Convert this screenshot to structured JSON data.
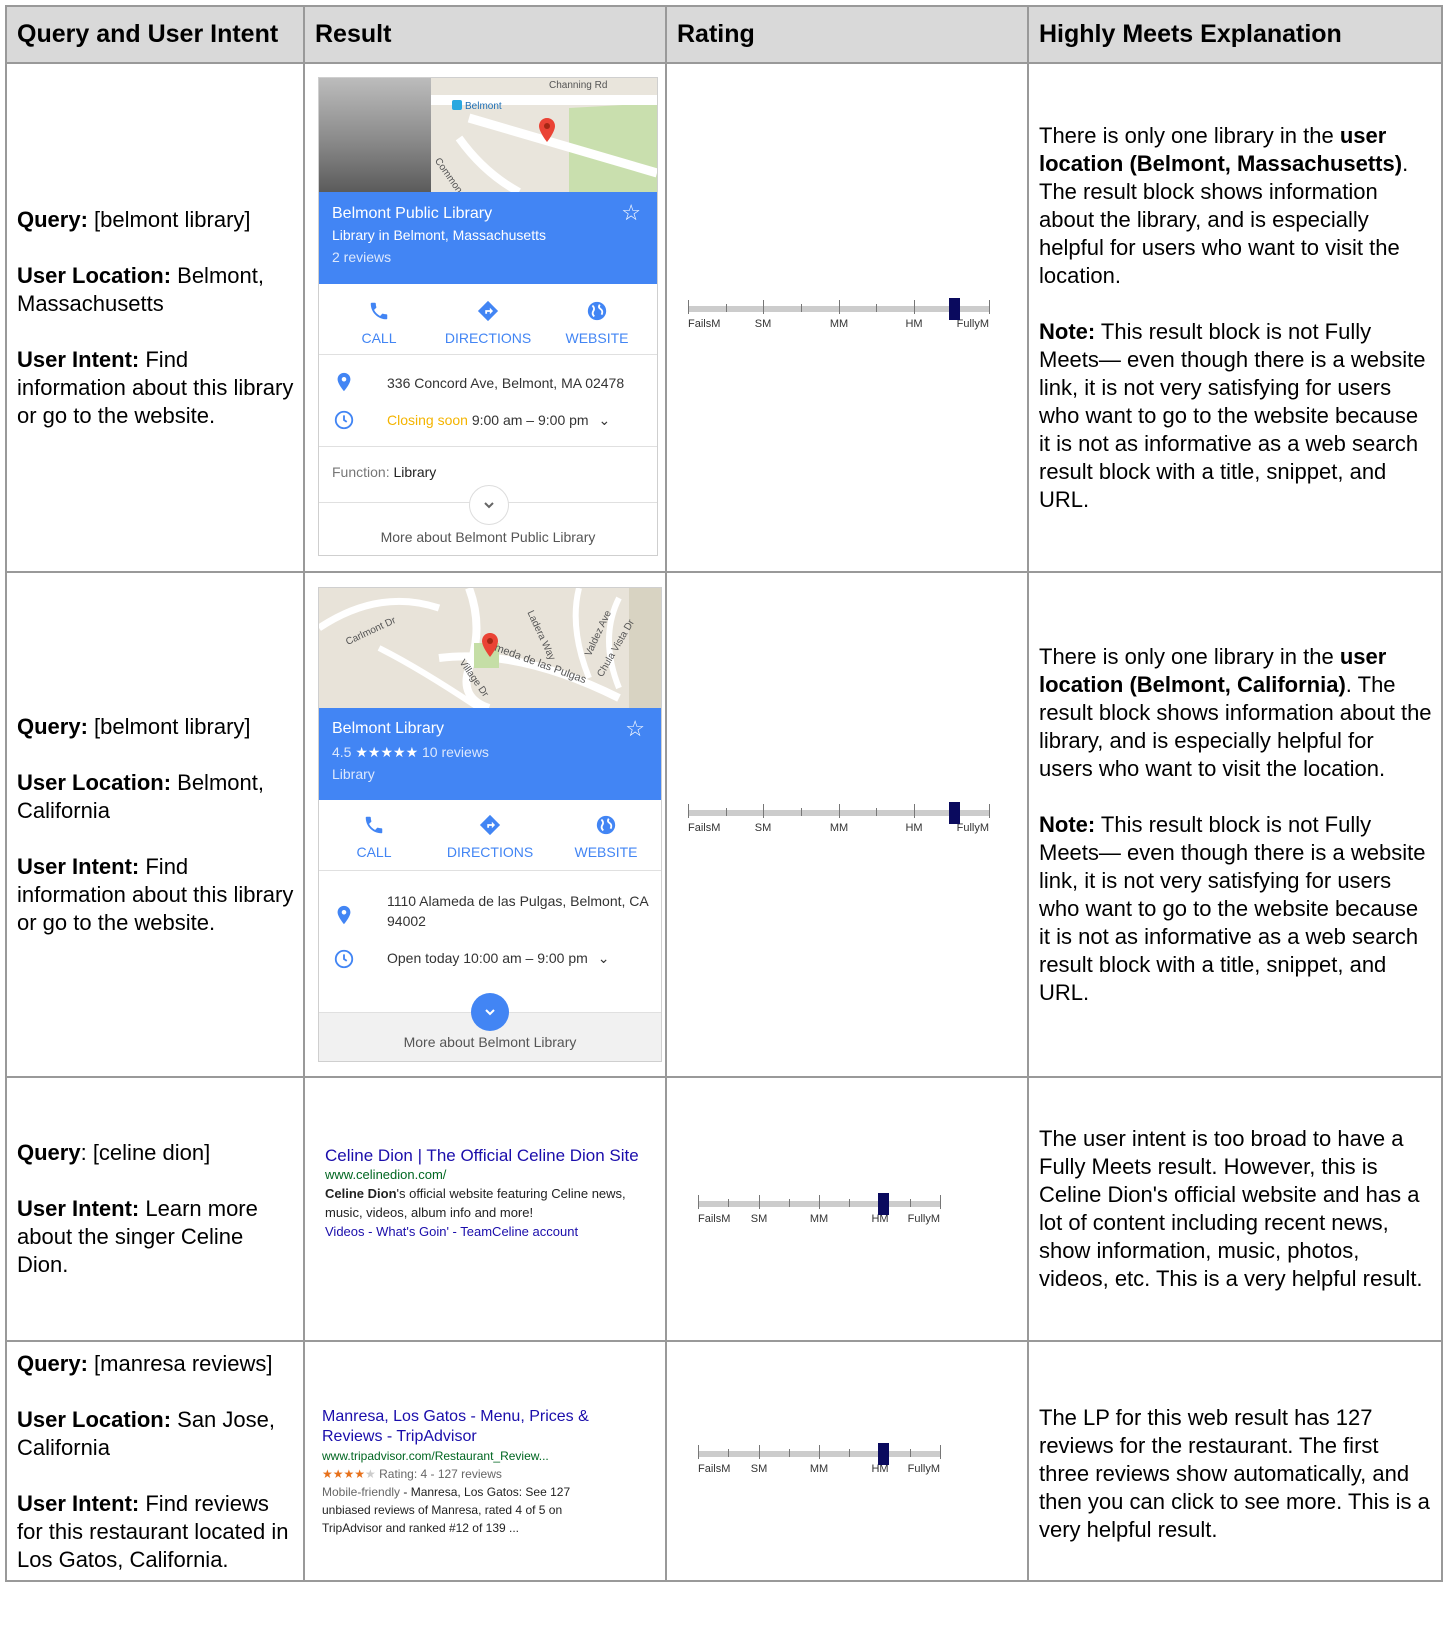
{
  "headers": {
    "query": "Query and User Intent",
    "result": "Result",
    "rating": "Rating",
    "explanation": "Highly Meets Explanation"
  },
  "rating_scale_labels": [
    "FailsM",
    "SM",
    "MM",
    "HM",
    "FullyM"
  ],
  "colors": {
    "header_bg": "#d9d9d9",
    "card_blue": "#4285f4",
    "link": "#1a0dab",
    "url_green": "#006621",
    "marker": "#0a0a5e",
    "closing_soon": "#f4b400"
  },
  "rows": [
    {
      "query_label": "Query:",
      "query": " [belmont library]",
      "location_label": "User Location:",
      "location": " Belmont, Massachusetts",
      "intent_label": "User Intent:",
      "intent": "  Find information about this library or go to the website.",
      "rating_position": 0.88,
      "card": {
        "map_road": "Channing Rd",
        "map_place": "Belmont",
        "map_street": "Common S",
        "name": "Belmont Public Library",
        "subtitle": "Library in Belmont, Massachusetts",
        "reviews": "2 reviews",
        "call": "CALL",
        "directions": "DIRECTIONS",
        "website": "WEBSITE",
        "address": "336 Concord Ave, Belmont, MA 02478",
        "hours_status": "Closing soon",
        "hours": " 9:00 am – 9:00 pm",
        "function_label": "Function: ",
        "function_value": "Library",
        "more": "More about Belmont Public Library"
      },
      "explanation": {
        "p1_a": "There is only one library in the ",
        "p1_bold": "user location (Belmont, Massachusetts)",
        "p1_b": ".  The result block shows information about the library, and is especially helpful for users who want to visit the location.",
        "note_label": "Note:",
        "note": " This result block is not Fully Meets— even though there is a website link, it is not very satisfying for users who want to go to the website because it is not as informative as a web search result block with a title, snippet, and URL."
      }
    },
    {
      "query_label": "Query:",
      "query": " [belmont library]",
      "location_label": "User Location:",
      "location": " Belmont, California",
      "intent_label": "User Intent:",
      "intent": "  Find information about this library or go to the website.",
      "rating_position": 0.88,
      "card": {
        "map_streets": [
          "Carlmont Dr",
          "Ladera Way",
          "Valdez Ave",
          "Chula Vista Dr",
          "meda de las Pulgas",
          "Village Dr"
        ],
        "name": "Belmont Library",
        "rating": "4.5",
        "stars": "★★★★★",
        "reviews": "10 reviews",
        "subtitle": "Library",
        "call": "CALL",
        "directions": "DIRECTIONS",
        "website": "WEBSITE",
        "address": "1110 Alameda de las Pulgas, Belmont, CA 94002",
        "hours": "Open today 10:00 am – 9:00 pm",
        "more": "More about Belmont Library"
      },
      "explanation": {
        "p1_a": "There is only one library in the ",
        "p1_bold": "user location (Belmont, California)",
        "p1_b": ".  The result block shows information about the library, and is especially helpful for users who want to visit the location.",
        "note_label": "Note:",
        "note": " This result block is not Fully Meets— even though there is a website link, it is not very satisfying for users who want to go to the website because it is not as informative as a web search result block with a title, snippet, and URL."
      }
    },
    {
      "query_label": "Query",
      "query": ": [celine dion]",
      "intent_label": "User Intent:",
      "intent": " Learn more about the singer Celine Dion.",
      "rating_position": 0.76,
      "web": {
        "title": "Celine Dion | The Official Celine Dion Site",
        "url": "www.celinedion.com/",
        "snippet_bold": "Celine Dion",
        "snippet": "'s official website featuring Celine news, music, videos, album info and more!",
        "links": "Videos - What's Goin' - TeamCeline account"
      },
      "explanation": {
        "p1": "The user intent is too broad to have a Fully Meets result. However, this is Celine Dion's official website and has a lot of content including recent news, show information, music, photos, videos, etc. This is a very helpful result."
      }
    },
    {
      "query_label": "Query:",
      "query": " [manresa reviews]",
      "location_label": "User Location:",
      "location": " San Jose, California",
      "intent_label": "User Intent:",
      "intent": " Find reviews for this restaurant located in Los Gatos, California.",
      "rating_position": 0.76,
      "web": {
        "title": "Manresa, Los Gatos - Menu, Prices & Reviews - TripAdvisor",
        "url": "www.tripadvisor.com/Restaurant_Review...",
        "stars_full": "★★★★",
        "stars_empty": "★",
        "rating_text": " Rating: 4 - 127 reviews",
        "mobile": "Mobile-friendly",
        "snippet": " - Manresa, Los Gatos: See 127 unbiased reviews of Manresa, rated 4 of 5 on TripAdvisor and ranked #12 of 139 ..."
      },
      "explanation": {
        "p1": "The LP for this web result has 127 reviews for the restaurant. The first three reviews show automatically, and then you can click to see more.  This is a very helpful result."
      }
    }
  ]
}
